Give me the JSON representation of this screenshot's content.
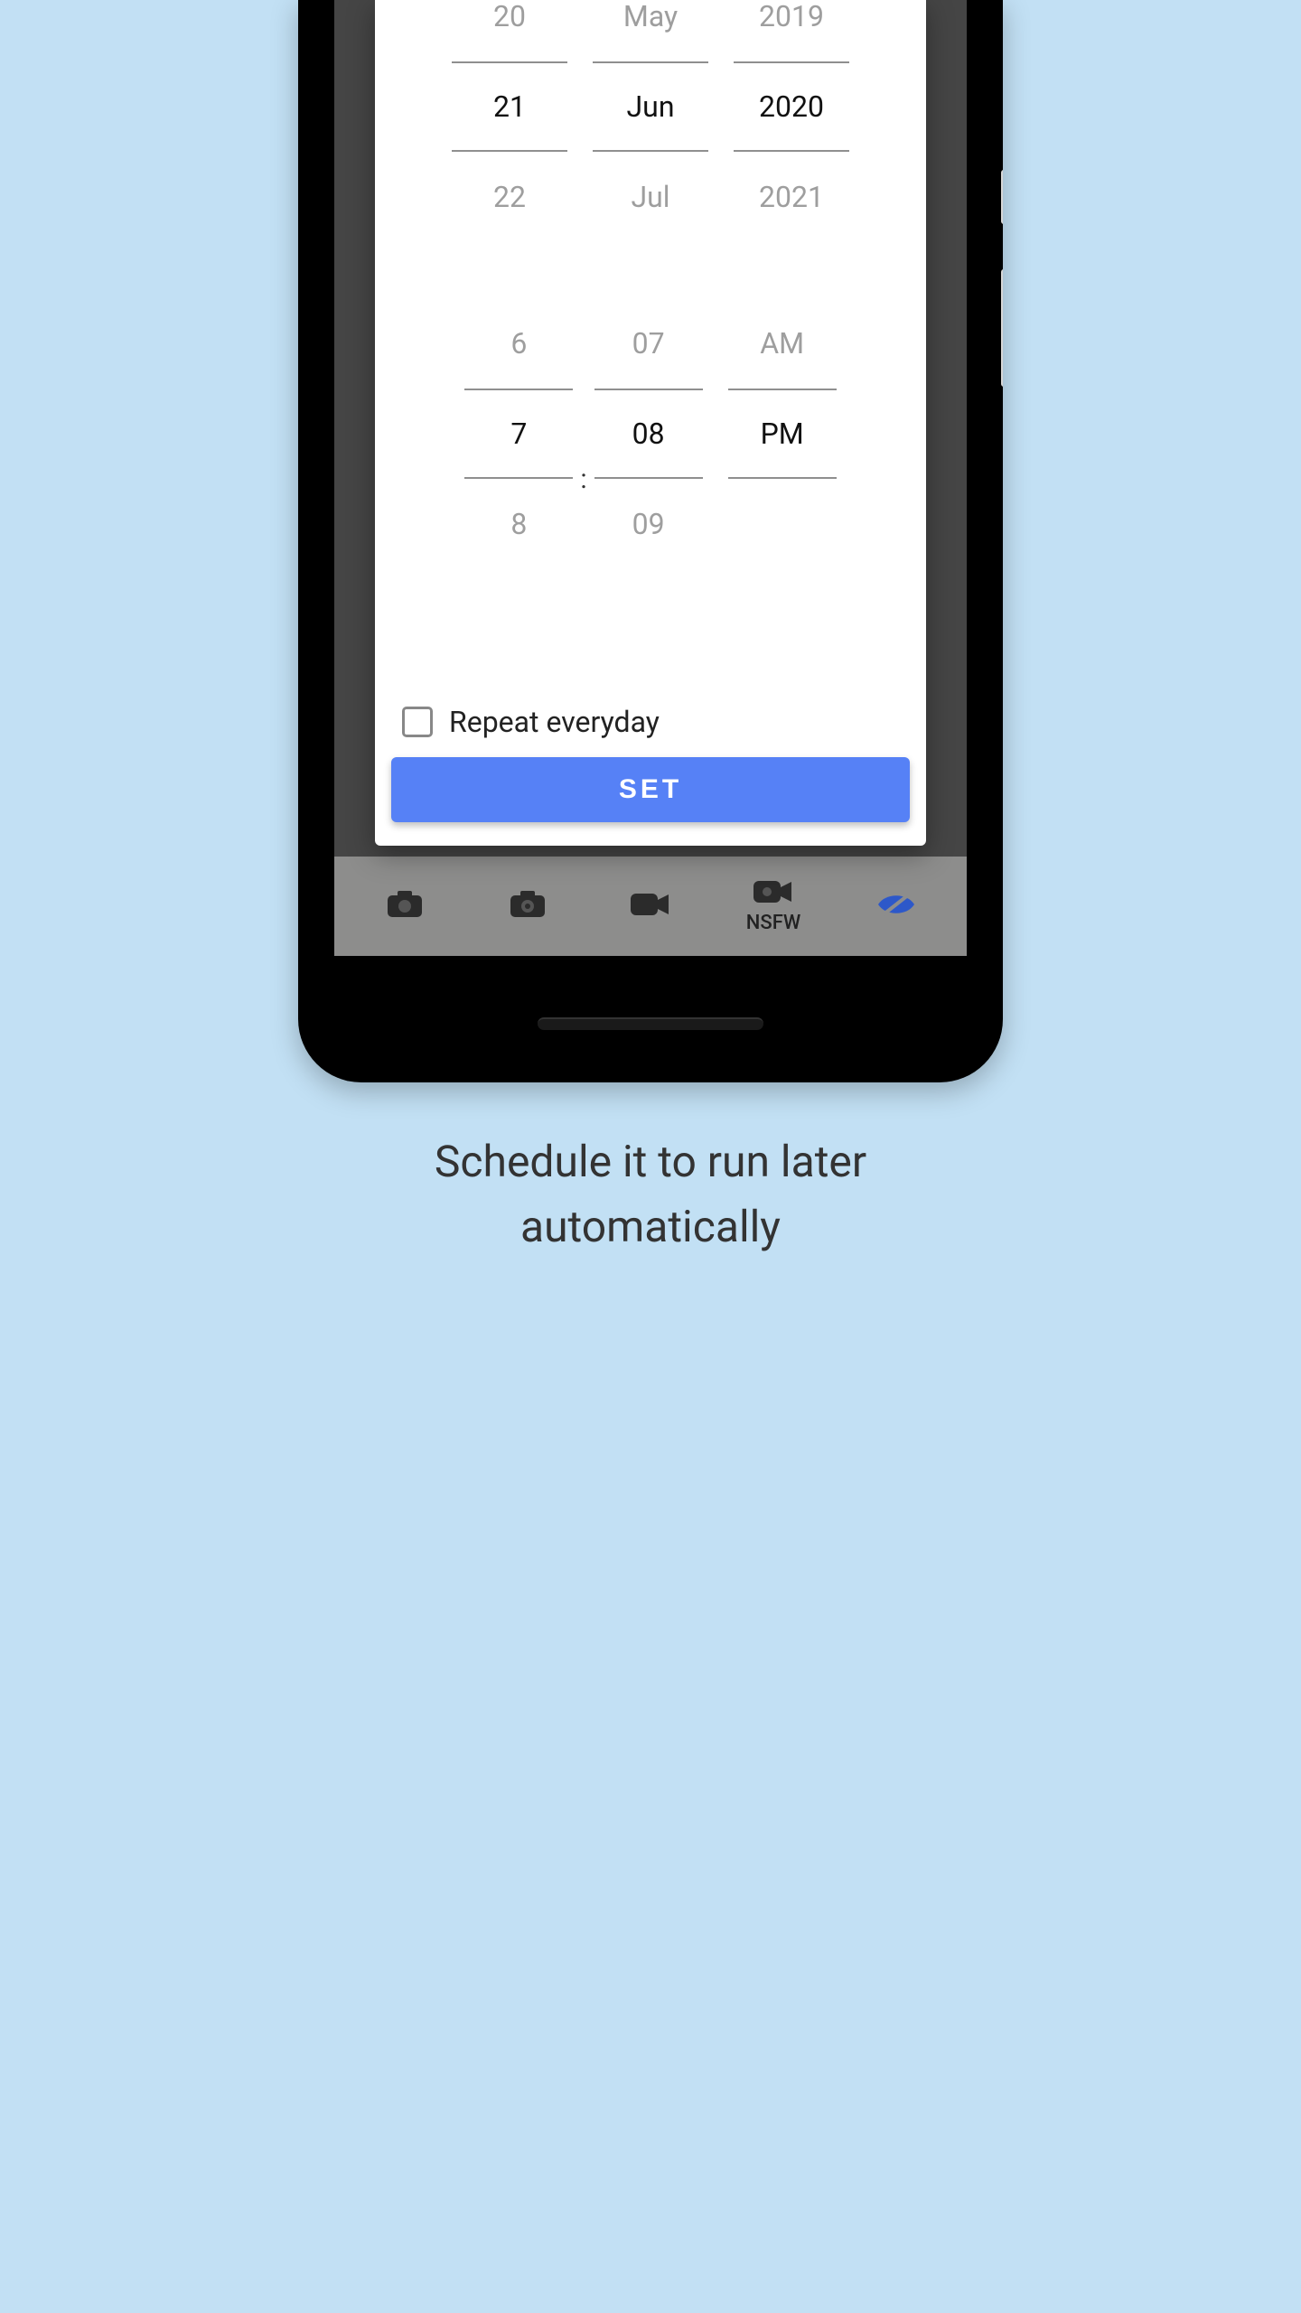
{
  "dialog": {
    "date_picker": {
      "day": {
        "prev": "20",
        "selected": "21",
        "next": "22"
      },
      "month": {
        "prev": "May",
        "selected": "Jun",
        "next": "Jul"
      },
      "year": {
        "prev": "2019",
        "selected": "2020",
        "next": "2021"
      }
    },
    "time_picker": {
      "hour": {
        "prev": "6",
        "selected": "7",
        "next": "8"
      },
      "minute": {
        "prev": "07",
        "selected": "08",
        "next": "09"
      },
      "period": {
        "prev": "AM",
        "selected": "PM",
        "next": ""
      }
    },
    "repeat_checkbox_label": "Repeat everyday",
    "repeat_checked": false,
    "set_button": "SET"
  },
  "bottom_nav": {
    "nsfw_label": "NSFW"
  },
  "caption": "Schedule it to run later automatically"
}
